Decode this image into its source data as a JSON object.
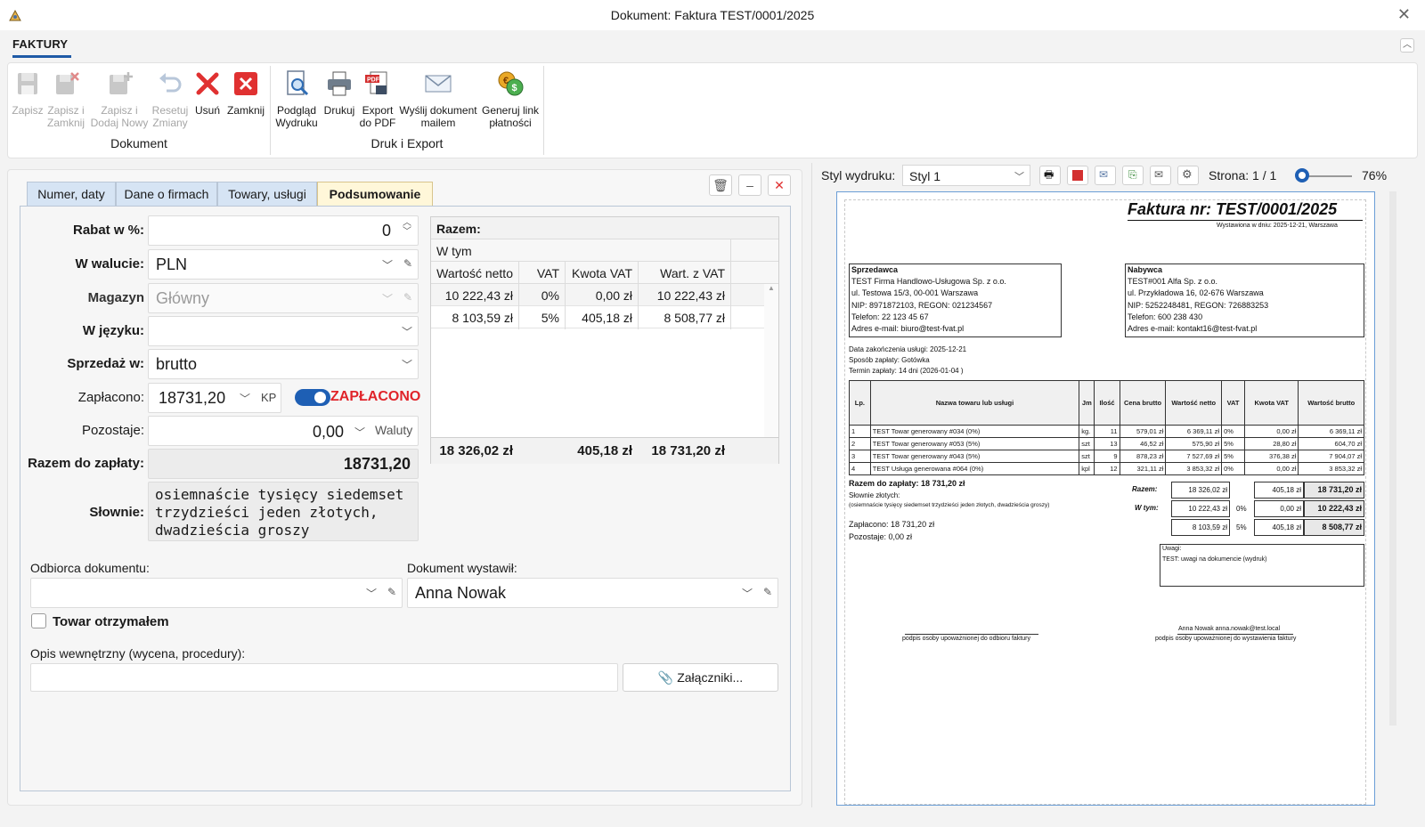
{
  "window": {
    "title": "Dokument: Faktura TEST/0001/2025"
  },
  "ribbon": {
    "tab": "FAKTURY",
    "groups": [
      {
        "label": "Dokument"
      },
      {
        "label": "Druk i Export"
      }
    ],
    "buttons": [
      {
        "l1": "Zapisz",
        "l2": "",
        "enabled": false
      },
      {
        "l1": "Zapisz i",
        "l2": "Zamknij",
        "enabled": false
      },
      {
        "l1": "Zapisz i",
        "l2": "Dodaj Nowy",
        "enabled": false
      },
      {
        "l1": "Resetuj",
        "l2": "Zmiany",
        "enabled": false
      },
      {
        "l1": "Usuń",
        "l2": "",
        "enabled": true
      },
      {
        "l1": "Zamknij",
        "l2": "",
        "enabled": true
      },
      {
        "l1": "Podgląd",
        "l2": "Wydruku",
        "enabled": true
      },
      {
        "l1": "Drukuj",
        "l2": "",
        "enabled": true
      },
      {
        "l1": "Export",
        "l2": "do PDF",
        "enabled": true
      },
      {
        "l1": "Wyślij dokument",
        "l2": "mailem",
        "enabled": true
      },
      {
        "l1": "Generuj link",
        "l2": "płatności",
        "enabled": true
      }
    ]
  },
  "tabs": [
    "Numer, daty",
    "Dane o firmach",
    "Towary, usługi",
    "Podsumowanie"
  ],
  "form": {
    "rabat_label": "Rabat w %:",
    "rabat_value": "0",
    "waluta_label": "W walucie:",
    "waluta_value": "PLN",
    "magazyn_label": "Magazyn",
    "magazyn_value": "Główny",
    "jezyk_label": "W języku:",
    "jezyk_value": "",
    "sprzedaz_label": "Sprzedaż w:",
    "sprzedaz_value": "brutto",
    "zaplacono_label": "Zapłacono:",
    "zaplacono_value": "18731,20",
    "zaplacono_unit": "KP",
    "zaplacono_toggle": "ZAPŁACONO",
    "zaplacono_on": true,
    "pozostaje_label": "Pozostaje:",
    "pozostaje_value": "0,00",
    "pozostaje_unit": "Waluty",
    "razem_label": "Razem do zapłaty:",
    "razem_value": "18731,20",
    "slownie_label": "Słownie:",
    "slownie_value": "osiemnaście tysięcy siedemset trzydzieści jeden złotych, dwadzieścia groszy",
    "odbiorca_label": "Odbiorca dokumentu:",
    "odbiorca_value": "",
    "wystawil_label": "Dokument wystawił:",
    "wystawil_value": "Anna Nowak",
    "towar_otrzymalem": "Towar otrzymałem",
    "opis_label": "Opis wewnętrzny (wycena, procedury):",
    "opis_value": "",
    "zalaczniki_button": "Załączniki..."
  },
  "razem_table": {
    "title": "Razem:",
    "wtym": "W tym",
    "headers": [
      "Wartość netto",
      "VAT",
      "Kwota VAT",
      "Wart. z VAT"
    ],
    "rows": [
      [
        "10 222,43 zł",
        "0%",
        "0,00 zł",
        "10 222,43 zł"
      ],
      [
        "8 103,59 zł",
        "5%",
        "405,18 zł",
        "8 508,77 zł"
      ]
    ],
    "totals": [
      "18 326,02 zł",
      "",
      "405,18 zł",
      "18 731,20 zł"
    ]
  },
  "preview": {
    "style_label": "Styl wydruku:",
    "style_value": "Styl 1",
    "page_label": "Strona: 1 / 1",
    "zoom": "76%",
    "doc": {
      "title": "Faktura nr: TEST/0001/2025",
      "issued": "Wystawiona w dniu: 2025-12-21, Warszawa",
      "seller_h": "Sprzedawca",
      "seller": [
        "TEST Firma Handlowo-Usługowa Sp. z o.o.",
        "ul. Testowa 15/3, 00-001 Warszawa",
        "NIP: 8971872103, REGON: 021234567",
        "Telefon: 22 123 45 67",
        "Adres e-mail: biuro@test-fvat.pl"
      ],
      "buyer_h": "Nabywca",
      "buyer": [
        "TEST#001 Alfa Sp. z o.o.",
        "ul. Przykładowa 16, 02-676 Warszawa",
        "NIP: 5252248481, REGON: 726883253",
        "Telefon: 600 238 430",
        "Adres e-mail: kontakt16@test-fvat.pl"
      ],
      "info": [
        "Data zakończenia usługi: 2025-12-21",
        "Sposób zapłaty: Gotówka",
        "Termin zapłaty: 14 dni (2026-01-04 )"
      ],
      "items_headers": [
        "Lp.",
        "Nazwa towaru lub usługi",
        "Jm",
        "Ilość",
        "Cena brutto",
        "Wartość netto",
        "VAT",
        "Kwota VAT",
        "Wartość brutto"
      ],
      "items": [
        [
          "1",
          "TEST Towar generowany #034 (0%)",
          "kg.",
          "11",
          "579,01 zł",
          "6 369,11 zł",
          "0%",
          "0,00 zł",
          "6 369,11 zł"
        ],
        [
          "2",
          "TEST Towar generowany #053 (5%)",
          "szt",
          "13",
          "46,52 zł",
          "575,90 zł",
          "5%",
          "28,80 zł",
          "604,70 zł"
        ],
        [
          "3",
          "TEST Towar generowany #043 (5%)",
          "szt",
          "9",
          "878,23 zł",
          "7 527,69 zł",
          "5%",
          "376,38 zł",
          "7 904,07 zł"
        ],
        [
          "4",
          "TEST Usługa generowana #064 (0%)",
          "kpl",
          "12",
          "321,11 zł",
          "3 853,32 zł",
          "0%",
          "0,00 zł",
          "3 853,32 zł"
        ]
      ],
      "razem_do_zaplaty": "Razem do zapłaty: 18 731,20 zł",
      "slownie_h": "Słownie złotych:",
      "slownie": "(osiemnaście tysięcy siedemset trzydzieści jeden złotych, dwadzieścia groszy)",
      "zaplacono": "Zapłacono: 18 731,20 zł",
      "pozostaje": "Pozostaje: 0,00 zł",
      "sum_razem_lbl": "Razem:",
      "sum_wtym_lbl": "W tym:",
      "sum_razem": [
        "18 326,02 zł",
        "",
        "405,18 zł",
        "18 731,20 zł"
      ],
      "sum_rows": [
        [
          "10 222,43 zł",
          "0%",
          "0,00 zł",
          "10 222,43 zł"
        ],
        [
          "8 103,59 zł",
          "5%",
          "405,18 zł",
          "8 508,77 zł"
        ]
      ],
      "uwagi_h": "Uwagi:",
      "uwagi": "TEST: uwagi na dokumencie (wydruk)",
      "sig_left": "podpis osoby upoważnionej do odbioru faktury",
      "sig_right_name": "Anna Nowak anna.nowak@test.local",
      "sig_right": "podpis osoby upoważnionej do wystawienia faktury"
    }
  }
}
